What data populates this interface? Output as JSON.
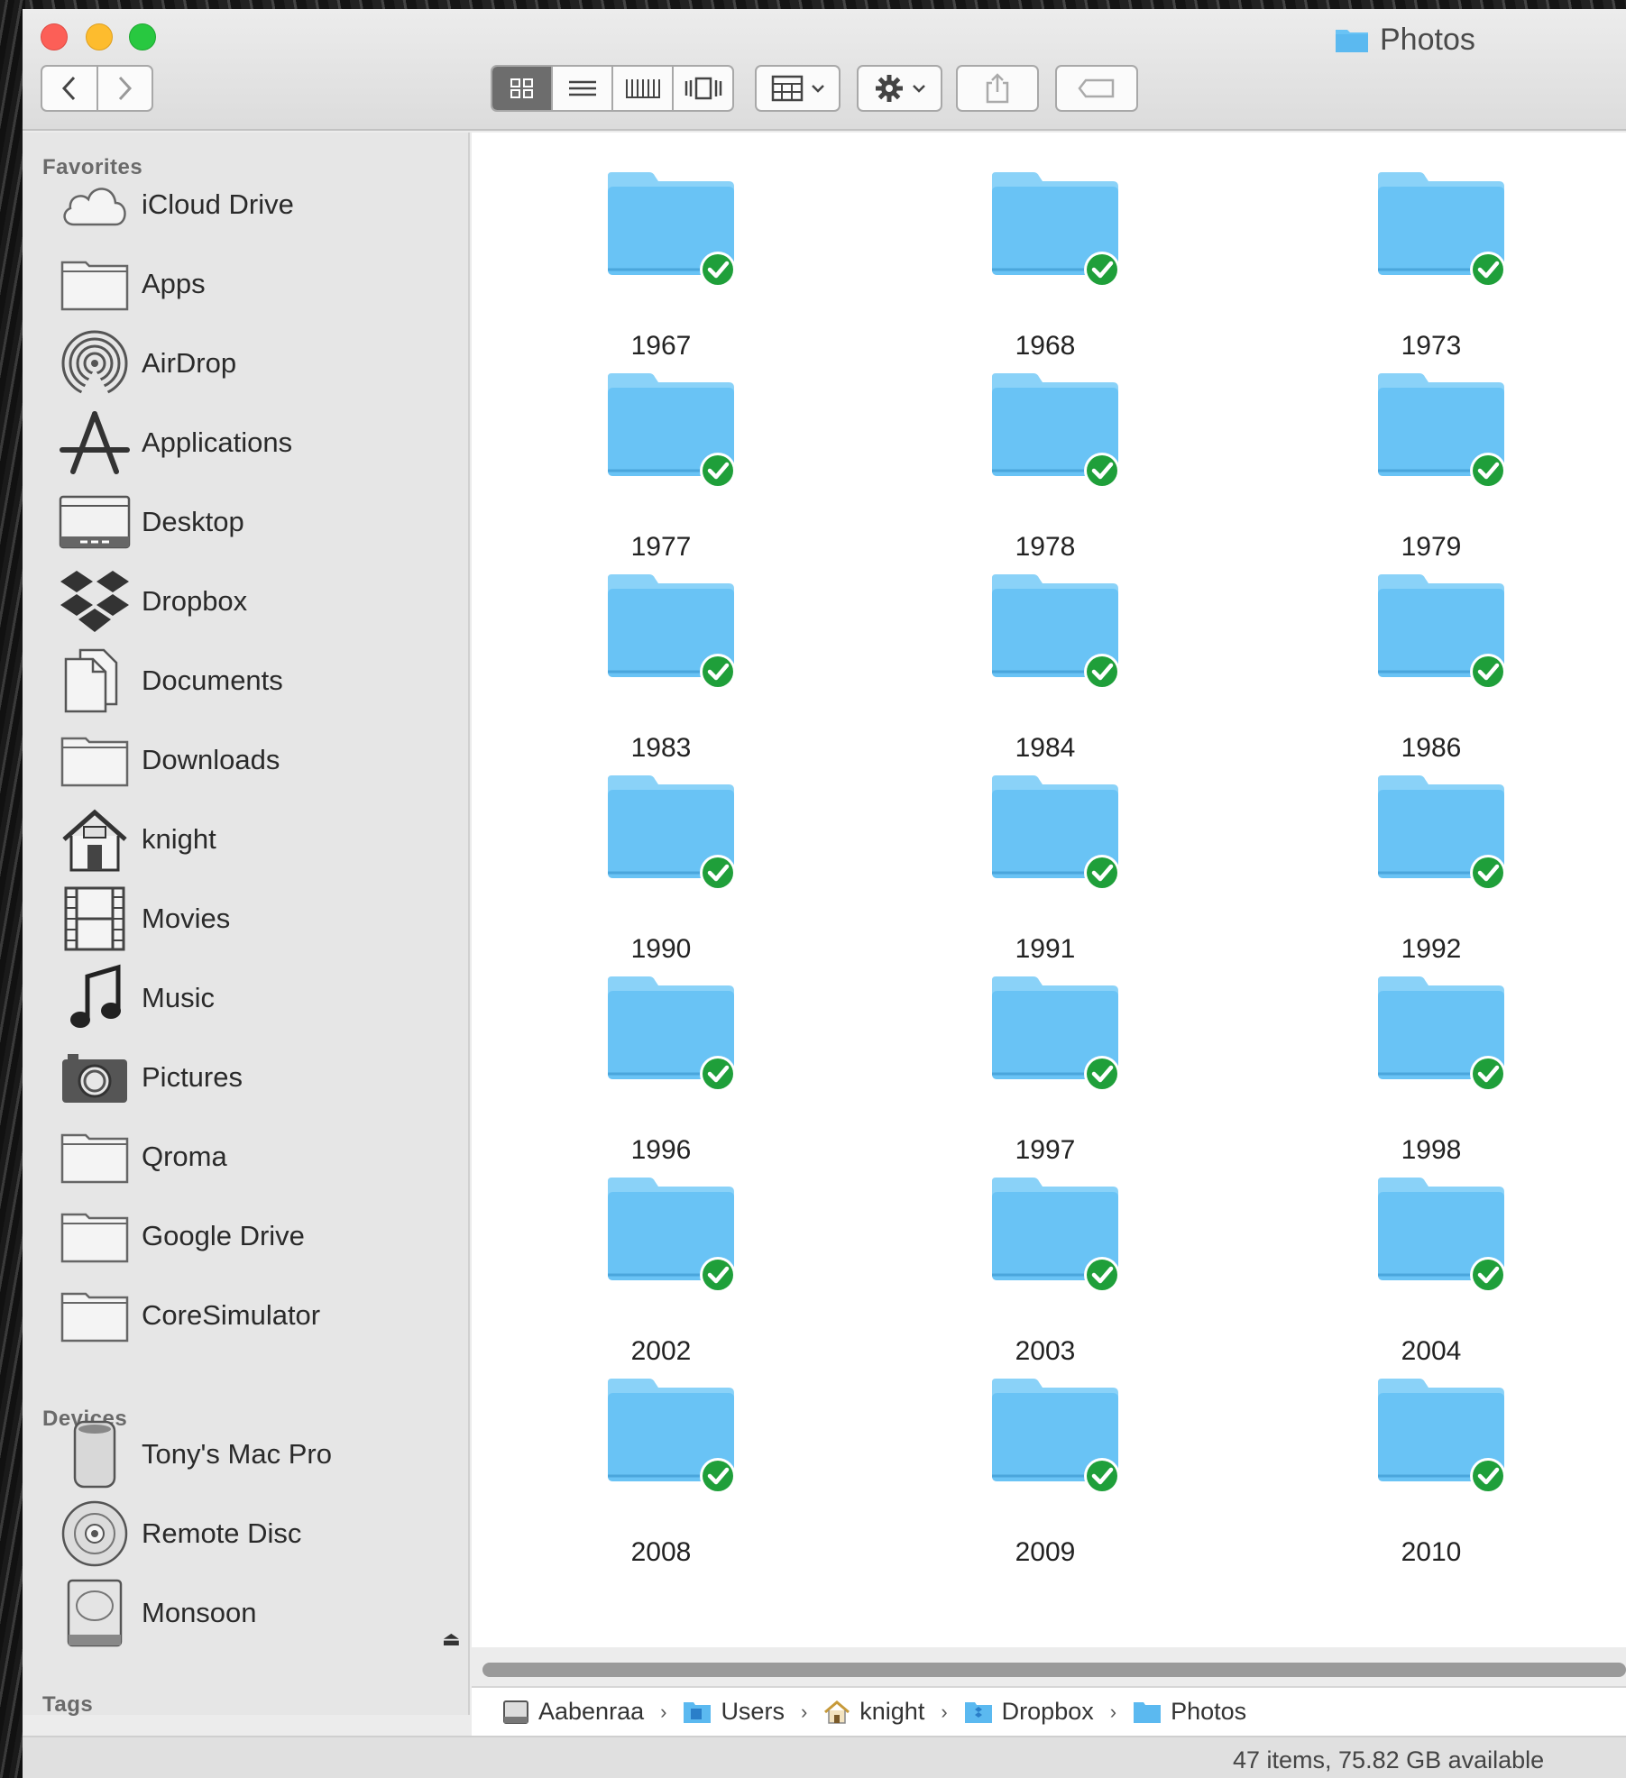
{
  "window": {
    "title": "Photos"
  },
  "toolbar": {
    "back_icon": "chevron-left-icon",
    "forward_icon": "chevron-right-icon",
    "views": [
      "icon-view-icon",
      "list-view-icon",
      "column-view-icon",
      "cover-flow-icon"
    ],
    "active_view": "icon-view-icon"
  },
  "sidebar": {
    "favorites_header": "Favorites",
    "favorites": [
      {
        "label": "iCloud Drive",
        "icon": "cloud-icon"
      },
      {
        "label": "Apps",
        "icon": "folder-icon"
      },
      {
        "label": "AirDrop",
        "icon": "airdrop-icon"
      },
      {
        "label": "Applications",
        "icon": "applications-icon"
      },
      {
        "label": "Desktop",
        "icon": "desktop-icon"
      },
      {
        "label": "Dropbox",
        "icon": "dropbox-icon"
      },
      {
        "label": "Documents",
        "icon": "documents-icon"
      },
      {
        "label": "Downloads",
        "icon": "folder-icon"
      },
      {
        "label": "knight",
        "icon": "home-icon"
      },
      {
        "label": "Movies",
        "icon": "film-icon"
      },
      {
        "label": "Music",
        "icon": "music-note-icon"
      },
      {
        "label": "Pictures",
        "icon": "camera-icon"
      },
      {
        "label": "Qroma",
        "icon": "folder-icon"
      },
      {
        "label": "Google Drive",
        "icon": "folder-icon"
      },
      {
        "label": "CoreSimulator",
        "icon": "folder-icon"
      }
    ],
    "devices_header": "Devices",
    "devices": [
      {
        "label": "Tony's Mac Pro",
        "icon": "mac-pro-icon"
      },
      {
        "label": "Remote Disc",
        "icon": "disc-icon"
      },
      {
        "label": "Monsoon",
        "icon": "hard-drive-icon"
      }
    ],
    "tags_header": "Tags"
  },
  "folders": [
    "1967",
    "1968",
    "1973",
    "1977",
    "1978",
    "1979",
    "1983",
    "1984",
    "1986",
    "1990",
    "1991",
    "1992",
    "1996",
    "1997",
    "1998",
    "2002",
    "2003",
    "2004",
    "2008",
    "2009",
    "2010"
  ],
  "colors": {
    "folder": "#69c3f5",
    "folder_tab": "#8ad2f8",
    "sync_badge": "#1f9f3a"
  },
  "pathbar": [
    {
      "label": "Aabenraa",
      "icon": "hard-drive-icon"
    },
    {
      "label": "Users",
      "icon": "folder-icon"
    },
    {
      "label": "knight",
      "icon": "home-icon"
    },
    {
      "label": "Dropbox",
      "icon": "dropbox-folder-icon"
    },
    {
      "label": "Photos",
      "icon": "folder-icon"
    }
  ],
  "status": {
    "text": "47 items, 75.82 GB available"
  }
}
